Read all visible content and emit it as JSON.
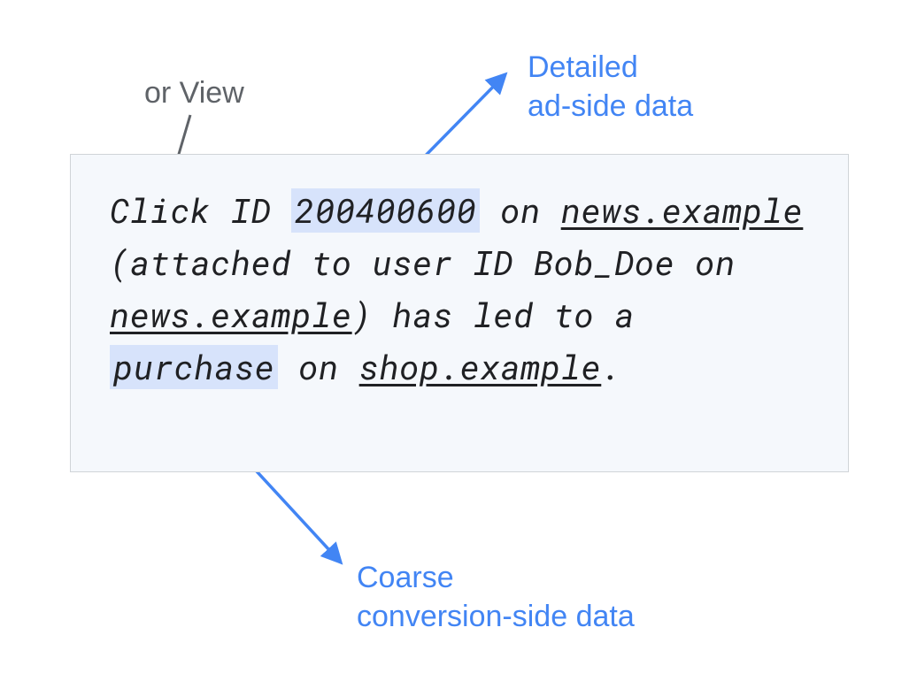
{
  "labels": {
    "top_gray": "or View",
    "top_blue": "Detailed\nad-side data",
    "bottom_blue": "Coarse\nconversion-side data"
  },
  "record": {
    "pre_id": "Click ID ",
    "click_id": "200400600",
    "post_id_pre_site1": " on ",
    "site1": "news.example",
    "mid1": " (attached to user ID Bob_Doe on ",
    "site1_again": "news.example",
    "mid2": ") has led to a ",
    "action": "purchase",
    "mid3": " on ",
    "site2": "shop.example",
    "tail": "."
  }
}
